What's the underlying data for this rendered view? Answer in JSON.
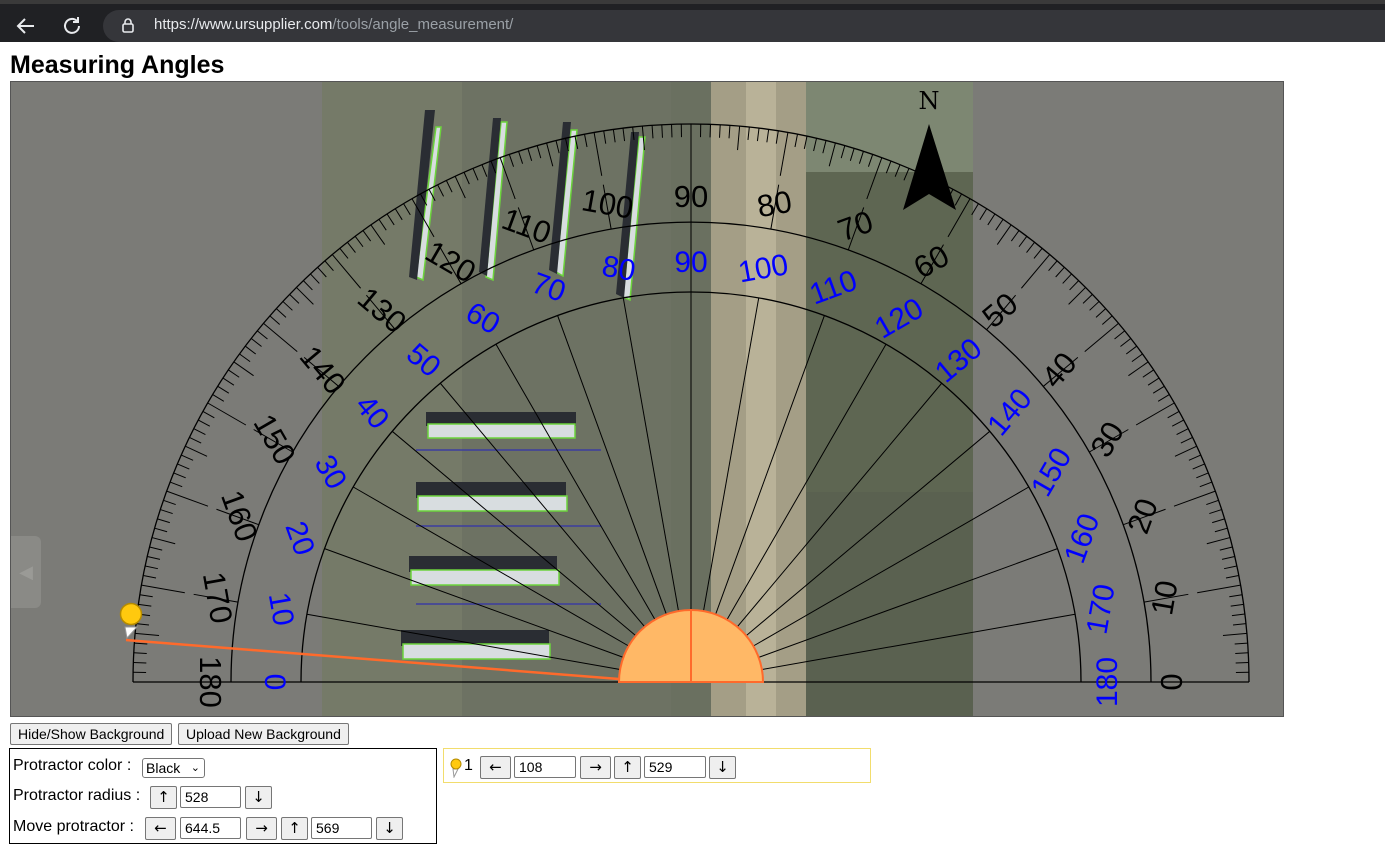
{
  "browser": {
    "url_domain": "https://www.ursupplier.com",
    "url_path": "/tools/angle_measurement/",
    "back_icon": "back-arrow-icon",
    "reload_icon": "reload-icon",
    "lock_icon": "lock-icon"
  },
  "page": {
    "title": "Measuring Angles"
  },
  "protractor": {
    "outer_labels": [
      "0",
      "10",
      "20",
      "30",
      "40",
      "50",
      "60",
      "70",
      "80",
      "90",
      "100",
      "110",
      "120",
      "130",
      "140",
      "150",
      "160",
      "170",
      "180"
    ],
    "inner_labels": [
      "0",
      "10",
      "20",
      "30",
      "40",
      "50",
      "60",
      "70",
      "80",
      "90",
      "100",
      "110",
      "120",
      "130",
      "140",
      "150",
      "160",
      "170",
      "180"
    ],
    "north_label": "N",
    "color": "#000000",
    "inner_color": "#0000ff",
    "line_color": "#ff6a2b",
    "hub_color": "#ffb866",
    "marker_color": "#ffc90e",
    "measured_angle_deg": 176
  },
  "buttons": {
    "hide_show": "Hide/Show Background",
    "upload": "Upload New Background"
  },
  "controls": {
    "color_label": "Protractor color :",
    "color_value": "Black",
    "radius_label": "Protractor radius :",
    "radius_value": "528",
    "move_label": "Move protractor :",
    "move_x": "644.5",
    "move_y": "569",
    "up": "↑",
    "down": "↓",
    "left": "←",
    "right": "→"
  },
  "marker": {
    "index": "1",
    "x": "108",
    "y": "529"
  }
}
